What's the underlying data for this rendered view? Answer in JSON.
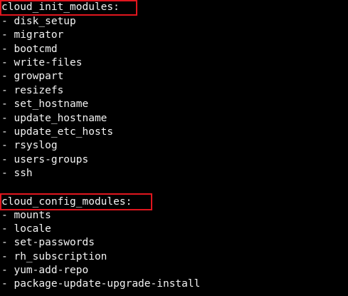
{
  "colors": {
    "background": "#000000",
    "text": "#f2f2f2",
    "highlight_box": "#e0161e"
  },
  "sections": [
    {
      "header": "cloud_init_modules:",
      "items": [
        "- disk_setup",
        "- migrator",
        "- bootcmd",
        "- write-files",
        "- growpart",
        "- resizefs",
        "- set_hostname",
        "- update_hostname",
        "- update_etc_hosts",
        "- rsyslog",
        "- users-groups",
        "- ssh"
      ]
    },
    {
      "header": "cloud_config_modules:",
      "items": [
        "- mounts",
        "- locale",
        "- set-passwords",
        "- rh_subscription",
        "- yum-add-repo",
        "- package-update-upgrade-install"
      ]
    }
  ]
}
